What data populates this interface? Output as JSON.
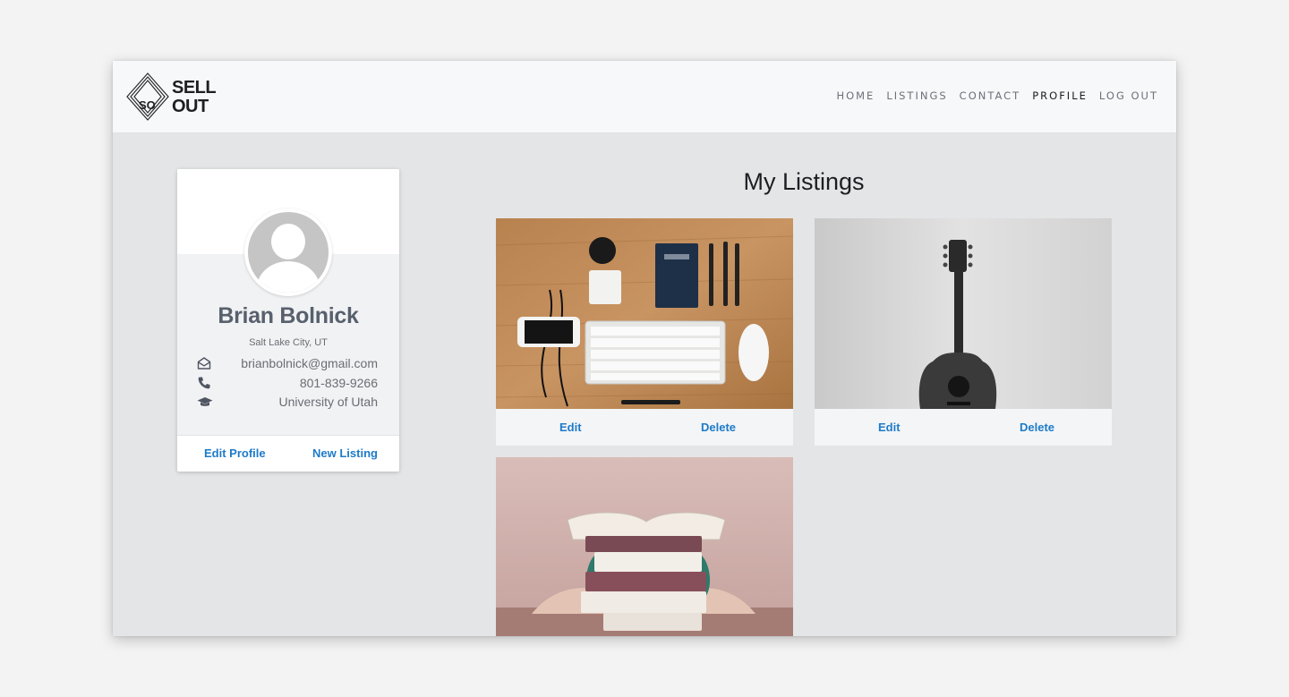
{
  "brand": {
    "badge": "SO",
    "line1": "SELL",
    "line2": "OUT"
  },
  "nav": {
    "items": [
      {
        "label": "HOME",
        "active": false
      },
      {
        "label": "LISTINGS",
        "active": false
      },
      {
        "label": "CONTACT",
        "active": false
      },
      {
        "label": "PROFILE",
        "active": true
      },
      {
        "label": "LOG OUT",
        "active": false
      }
    ]
  },
  "profile": {
    "name": "Brian Bolnick",
    "location": "Salt Lake City, UT",
    "email": "brianbolnick@gmail.com",
    "phone": "801-839-9266",
    "school": "University of Utah",
    "edit_label": "Edit Profile",
    "new_listing_label": "New Listing",
    "icons": {
      "email": "envelope-open-icon",
      "phone": "phone-icon",
      "school": "graduation-cap-icon"
    }
  },
  "listings": {
    "title": "My Listings",
    "items": [
      {
        "image": "desk-flatlay-photo",
        "edit_label": "Edit",
        "delete_label": "Delete"
      },
      {
        "image": "acoustic-guitar-photo",
        "edit_label": "Edit",
        "delete_label": "Delete"
      },
      {
        "image": "book-stack-photo"
      }
    ]
  },
  "colors": {
    "accent": "#1e7bc9",
    "name": "#58606d",
    "background": "#e4e5e7"
  }
}
